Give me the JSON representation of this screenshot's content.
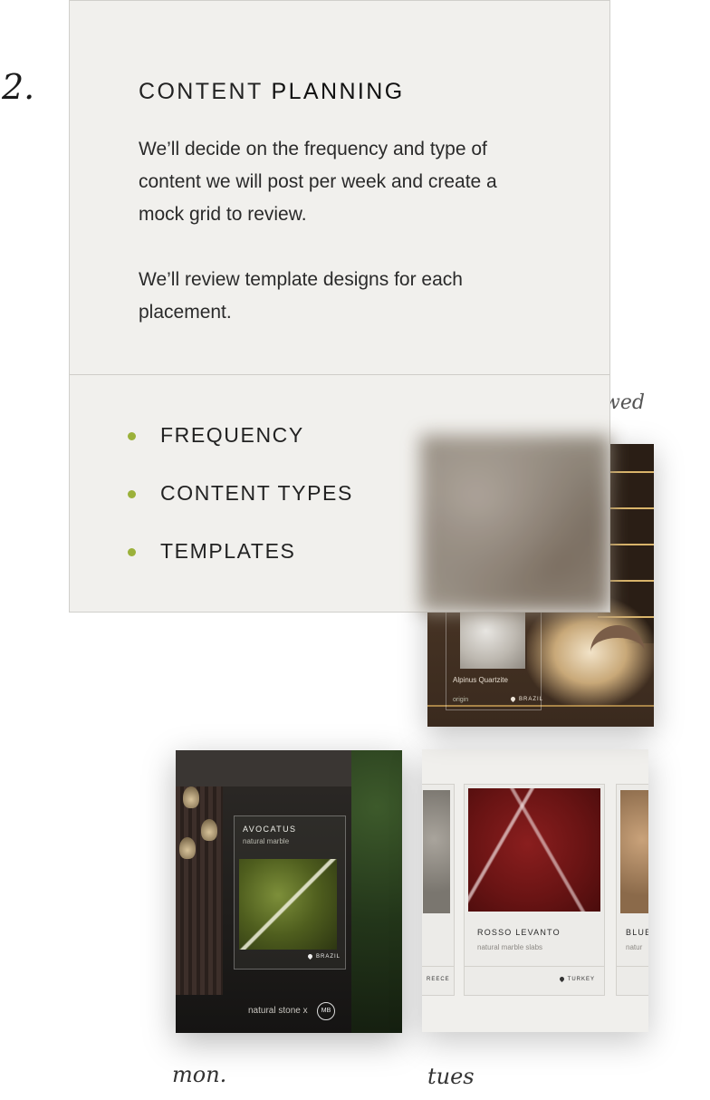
{
  "step": {
    "number": "2."
  },
  "panel": {
    "heading_light": "CONTENT",
    "heading_strong": "PLANNING",
    "paragraph_1": "We’ll decide on the frequency and type of content we will post per week and create a mock grid to review.",
    "paragraph_2": "We’ll review template designs for each placement.",
    "bullets": [
      {
        "label": "FREQUENCY"
      },
      {
        "label": "CONTENT TYPES"
      },
      {
        "label": "TEMPLATES"
      }
    ],
    "accent_color": "#9bb13a"
  },
  "days": {
    "wed": "wed",
    "mon": "mon.",
    "tues": "tues"
  },
  "cards": {
    "wed": {
      "stone_name": "Alpinus Quartzite",
      "origin_label": "origin",
      "country": "BRAZIL"
    },
    "mon": {
      "title": "AVOCATUS",
      "subtitle": "natural marble",
      "country": "BRAZIL",
      "footer": "natural stone  x",
      "badge": "MB"
    },
    "tues": {
      "left_country": "REECE",
      "title": "ROSSO LEVANTO",
      "subtitle": "natural marble slabs",
      "country": "TURKEY",
      "right_title": "BLUE",
      "right_subtitle": "natur"
    }
  }
}
